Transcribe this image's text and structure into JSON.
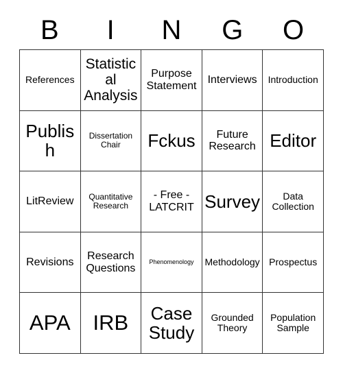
{
  "card": {
    "title": "BINGO",
    "header_letters": [
      "B",
      "I",
      "N",
      "G",
      "O"
    ],
    "colors": {
      "background": "#ffffff",
      "text": "#000000",
      "grid_line": "#333333"
    },
    "grid": {
      "columns": 5,
      "rows": 5,
      "free_space_index": 12
    },
    "cells": [
      {
        "text": "References",
        "size": "fs-sm",
        "free": false
      },
      {
        "text": "Statistical\nAnalysis",
        "size": "fs-lg",
        "free": false
      },
      {
        "text": "Purpose\nStatement",
        "size": "fs-md",
        "free": false
      },
      {
        "text": "Interviews",
        "size": "fs-md",
        "free": false
      },
      {
        "text": "Introduction",
        "size": "fs-sm",
        "free": false
      },
      {
        "text": "Publish",
        "size": "fs-xl",
        "free": false
      },
      {
        "text": "Dissertation\nChair",
        "size": "fs-xs",
        "free": false
      },
      {
        "text": "Fckus",
        "size": "fs-xl",
        "free": false
      },
      {
        "text": "Future\nResearch",
        "size": "fs-md",
        "free": false
      },
      {
        "text": "Editor",
        "size": "fs-xl",
        "free": false
      },
      {
        "text": "LitReview",
        "size": "fs-md",
        "free": false
      },
      {
        "text": "Quantitative\nResearch",
        "size": "fs-xs",
        "free": false
      },
      {
        "text": "- Free -\nLATCRIT",
        "size": "fs-md",
        "free": true
      },
      {
        "text": "Survey",
        "size": "fs-xl",
        "free": false
      },
      {
        "text": "Data\nCollection",
        "size": "fs-sm",
        "free": false
      },
      {
        "text": "Revisions",
        "size": "fs-md",
        "free": false
      },
      {
        "text": "Research\nQuestions",
        "size": "fs-md",
        "free": false
      },
      {
        "text": "Phenomenology",
        "size": "fs-xxs",
        "free": false
      },
      {
        "text": "Methodology",
        "size": "fs-sm",
        "free": false
      },
      {
        "text": "Prospectus",
        "size": "fs-sm",
        "free": false
      },
      {
        "text": "APA",
        "size": "fs-xxl",
        "free": false
      },
      {
        "text": "IRB",
        "size": "fs-xxl",
        "free": false
      },
      {
        "text": "Case\nStudy",
        "size": "fs-xl",
        "free": false
      },
      {
        "text": "Grounded\nTheory",
        "size": "fs-sm",
        "free": false
      },
      {
        "text": "Population\nSample",
        "size": "fs-sm",
        "free": false
      }
    ]
  }
}
